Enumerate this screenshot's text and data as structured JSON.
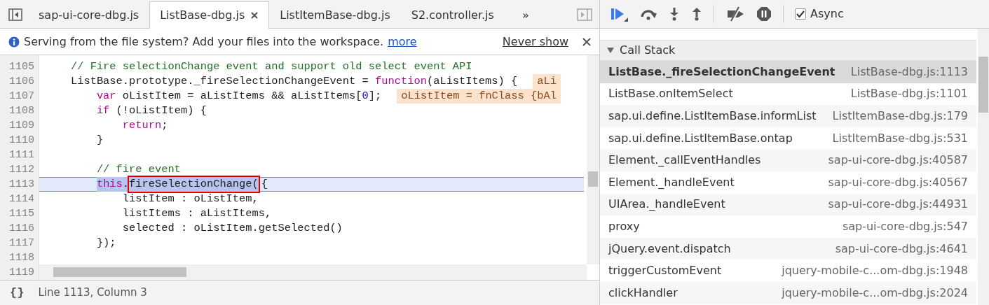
{
  "tabs": [
    {
      "label": "sap-ui-core-dbg.js",
      "selected": false
    },
    {
      "label": "ListBase-dbg.js",
      "selected": true
    },
    {
      "label": "ListItemBase-dbg.js",
      "selected": false
    },
    {
      "label": "S2.controller.js",
      "selected": false
    }
  ],
  "more_tabs": "»",
  "infobar": {
    "message": "Serving from the file system? Add your files into the workspace.",
    "link": "more",
    "dismiss": "Never show"
  },
  "code": {
    "lines": [
      {
        "number": "1105",
        "tokens": [
          {
            "kind": "comment",
            "text": "    // Fire selectionChange event and support old select event API"
          }
        ]
      },
      {
        "number": "1106",
        "tokens": [
          {
            "kind": "plain",
            "text": "    ListBase.prototype._fireSelectionChangeEvent = "
          },
          {
            "kind": "keyword",
            "text": "function"
          },
          {
            "kind": "plain",
            "text": "(aListItems) {"
          }
        ],
        "inline_value": "aLi"
      },
      {
        "number": "1107",
        "tokens": [
          {
            "kind": "keyword",
            "text": "        var"
          },
          {
            "kind": "plain",
            "text": " oListItem = aListItems && aListItems["
          },
          {
            "kind": "number",
            "text": "0"
          },
          {
            "kind": "plain",
            "text": "];"
          }
        ],
        "inline_value": "oListItem = fnClass {bAl"
      },
      {
        "number": "1108",
        "tokens": [
          {
            "kind": "keyword",
            "text": "        if"
          },
          {
            "kind": "plain",
            "text": " (!oListItem) {"
          }
        ]
      },
      {
        "number": "1109",
        "tokens": [
          {
            "kind": "keyword",
            "text": "            return"
          },
          {
            "kind": "plain",
            "text": ";"
          }
        ]
      },
      {
        "number": "1110",
        "tokens": [
          {
            "kind": "plain",
            "text": "        }"
          }
        ]
      },
      {
        "number": "1111"
      },
      {
        "number": "1112",
        "tokens": [
          {
            "kind": "comment",
            "text": "        // fire event"
          }
        ]
      },
      {
        "number": "1113",
        "current": true,
        "tokens": [
          {
            "kind": "keyword",
            "text": "this",
            "selected": true,
            "outlined": false
          },
          {
            "kind": "plain",
            "text": ".",
            "selected": true,
            "outlined": false
          },
          {
            "kind": "plain",
            "text": "fireSelectionChange(",
            "selected": true,
            "outlined": true
          },
          {
            "kind": "plain",
            "text": "{",
            "selected": false,
            "outlined": false
          }
        ]
      },
      {
        "number": "1114",
        "tokens": [
          {
            "kind": "plain",
            "text": "            listItem : oListItem,"
          }
        ]
      },
      {
        "number": "1115",
        "tokens": [
          {
            "kind": "plain",
            "text": "            listItems : aListItems,"
          }
        ]
      },
      {
        "number": "1116",
        "tokens": [
          {
            "kind": "plain",
            "text": "            selected : oListItem.getSelected()"
          }
        ]
      },
      {
        "number": "1117",
        "tokens": [
          {
            "kind": "plain",
            "text": "        });"
          }
        ]
      },
      {
        "number": "1118"
      },
      {
        "number": "1119"
      }
    ]
  },
  "status_bar": {
    "position": "Line 1113, Column 3",
    "format_label": "{}"
  },
  "debugger": {
    "async_label": "Async",
    "async_checked": true
  },
  "call_stack": {
    "title": "Call Stack",
    "expanded": true,
    "frames": [
      {
        "name": "ListBase._fireSelectionChangeEvent",
        "location": "ListBase-dbg.js:1113",
        "selected": true
      },
      {
        "name": "ListBase.onItemSelect",
        "location": "ListBase-dbg.js:1101",
        "selected": false
      },
      {
        "name": "sap.ui.define.ListItemBase.informList",
        "location": "ListItemBase-dbg.js:179",
        "selected": false
      },
      {
        "name": "sap.ui.define.ListItemBase.ontap",
        "location": "ListItemBase-dbg.js:531",
        "selected": false
      },
      {
        "name": "Element._callEventHandles",
        "location": "sap-ui-core-dbg.js:40587",
        "selected": false
      },
      {
        "name": "Element._handleEvent",
        "location": "sap-ui-core-dbg.js:40567",
        "selected": false
      },
      {
        "name": "UIArea._handleEvent",
        "location": "sap-ui-core-dbg.js:44931",
        "selected": false
      },
      {
        "name": "proxy",
        "location": "sap-ui-core-dbg.js:547",
        "selected": false
      },
      {
        "name": "jQuery.event.dispatch",
        "location": "sap-ui-core-dbg.js:4641",
        "selected": false
      },
      {
        "name": "triggerCustomEvent",
        "location": "jquery-mobile-c...om-dbg.js:1948",
        "selected": false
      },
      {
        "name": "clickHandler",
        "location": "jquery-mobile-c...om-dbg.js:2024",
        "selected": false
      }
    ]
  }
}
